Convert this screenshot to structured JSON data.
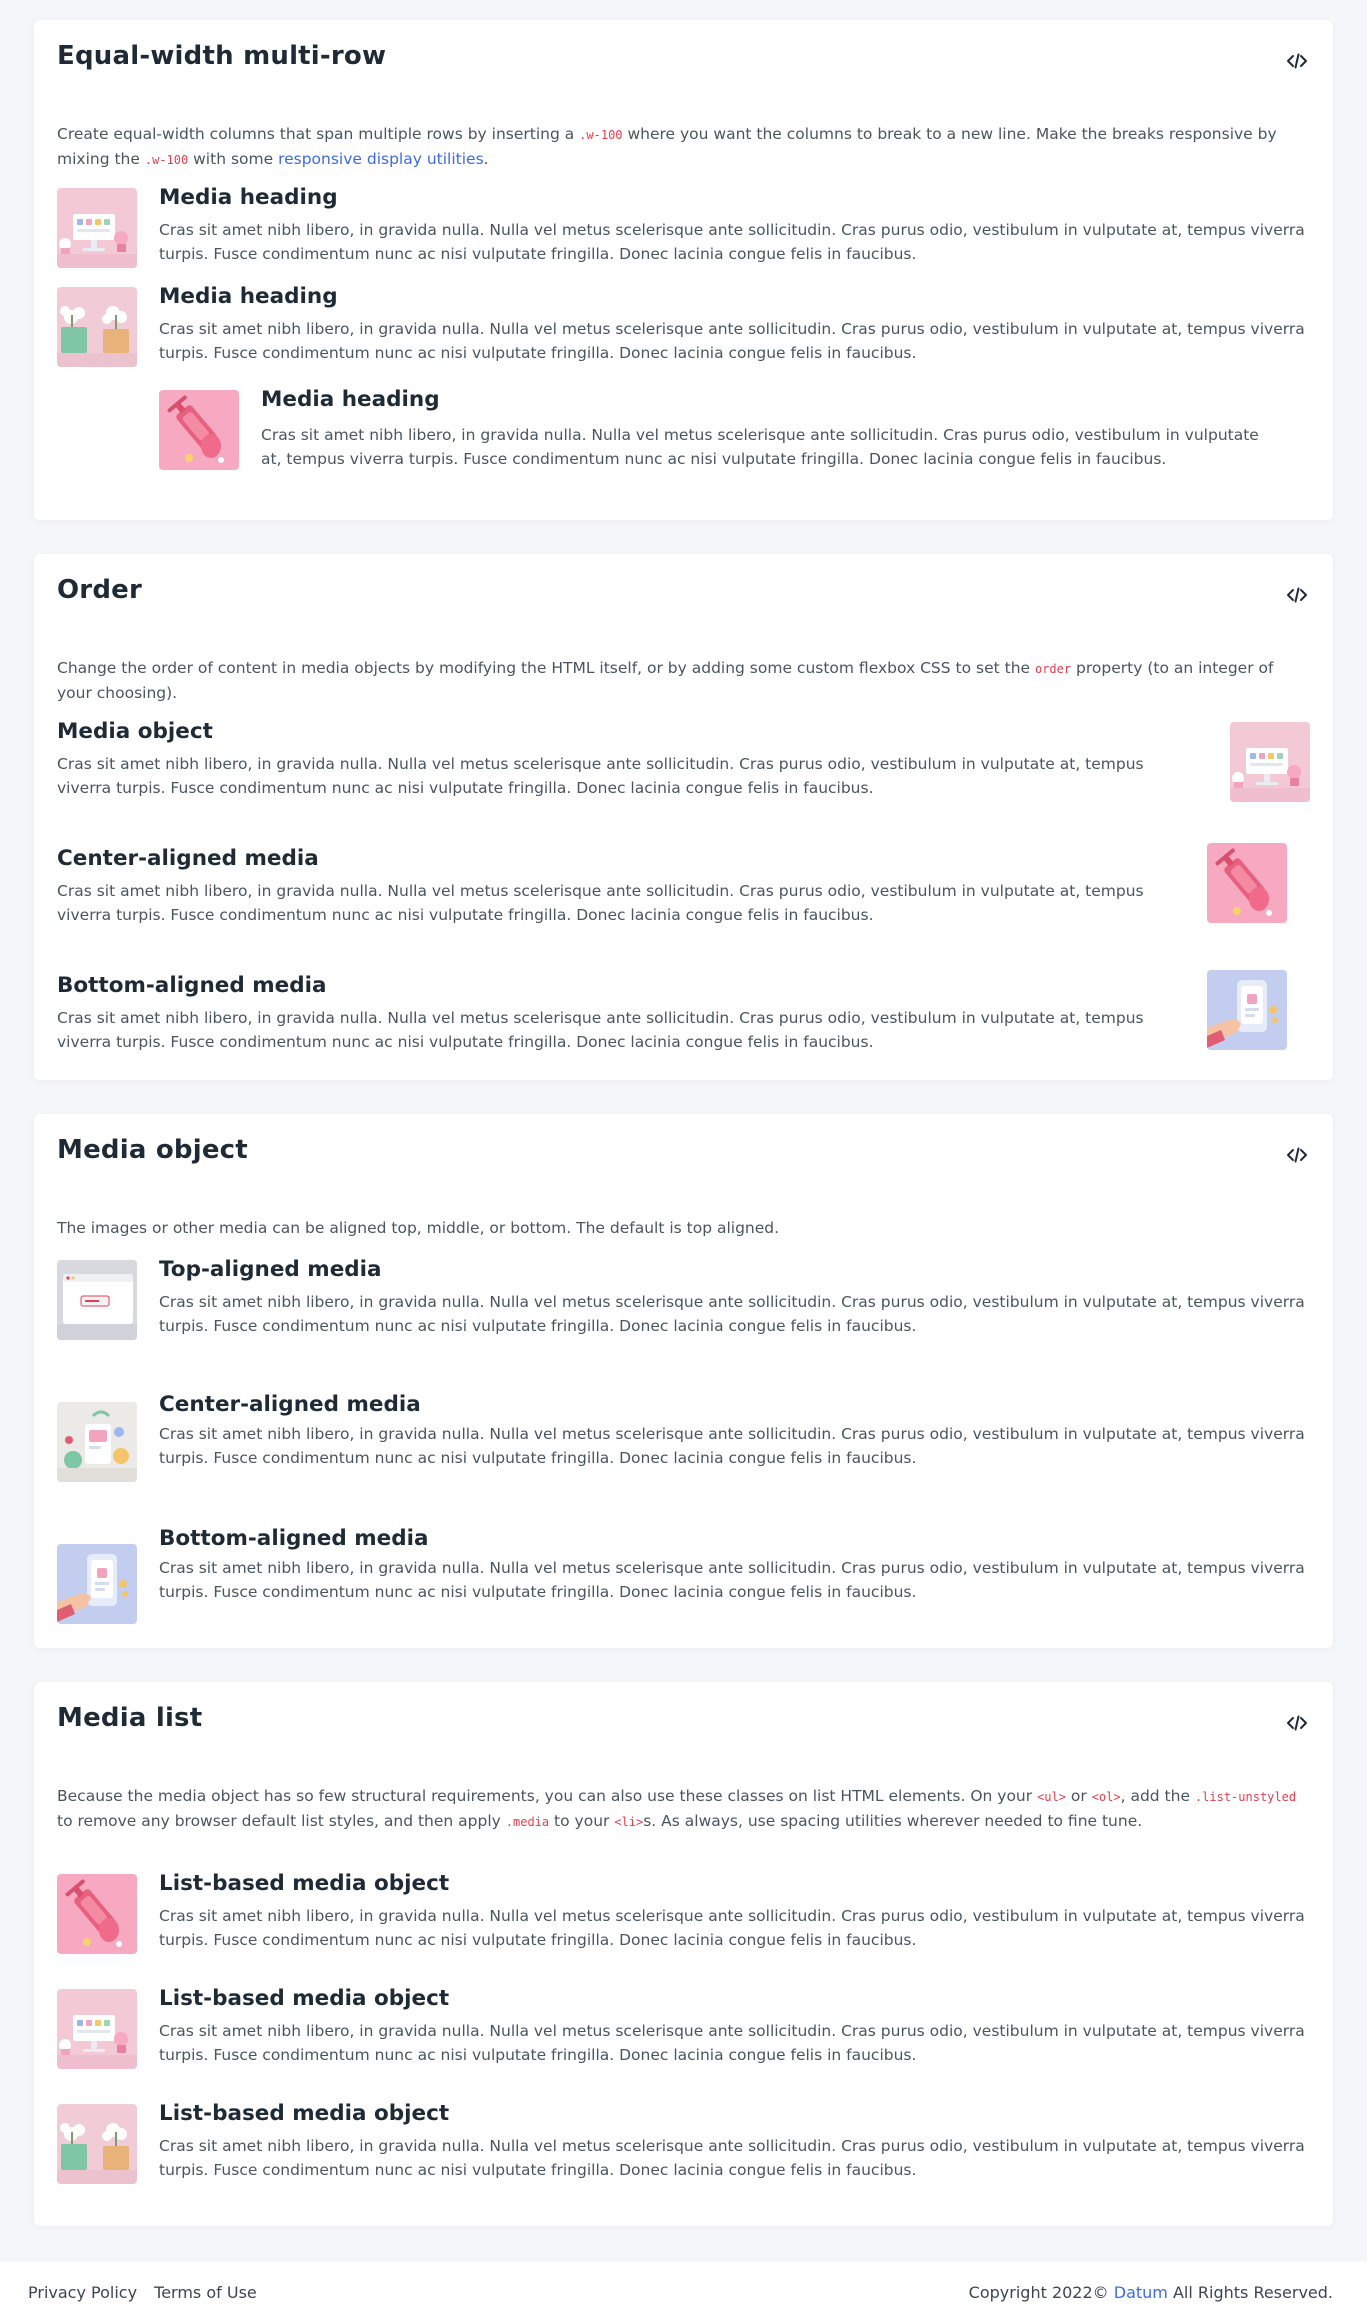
{
  "cards": [
    {
      "title": "Equal-width multi-row",
      "desc_a": "Create equal-width columns that span multiple rows by inserting a ",
      "code_a": ".w-100",
      "desc_b": " where you want the columns to break to a new line. Make the breaks responsive by mixing the ",
      "code_b": ".w-100",
      "desc_c": " with some ",
      "link": "responsive display utilities",
      "desc_d": ".",
      "items": [
        {
          "heading": "Media heading",
          "text": "Cras sit amet nibh libero, in gravida nulla. Nulla vel metus scelerisque ante sollicitudin. Cras purus odio, vestibulum in vulputate at, tempus viverra turpis. Fusce condimentum nunc ac nisi vulputate fringilla. Donec lacinia congue felis in faucibus.",
          "image": "desk-illustration"
        },
        {
          "heading": "Media heading",
          "text": "Cras sit amet nibh libero, in gravida nulla. Nulla vel metus scelerisque ante sollicitudin. Cras purus odio, vestibulum in vulputate at, tempus viverra turpis. Fusce condimentum nunc ac nisi vulputate fringilla. Donec lacinia congue felis in faucibus.",
          "image": "flower-pots-illustration"
        },
        {
          "heading": "Media heading",
          "text": "Cras sit amet nibh libero, in gravida nulla. Nulla vel metus scelerisque ante sollicitudin. Cras purus odio, vestibulum in vulputate at, tempus viverra turpis. Fusce condimentum nunc ac nisi vulputate fringilla. Donec lacinia congue felis in faucibus.",
          "image": "syringe-illustration"
        }
      ]
    },
    {
      "title": "Order",
      "desc_a": "Change the order of content in media objects by modifying the HTML itself, or by adding some custom flexbox CSS to set the ",
      "code_a": "order",
      "desc_b": " property (to an integer of your choosing).",
      "items": [
        {
          "heading": "Media object",
          "text": "Cras sit amet nibh libero, in gravida nulla. Nulla vel metus scelerisque ante sollicitudin. Cras purus odio, vestibulum in vulputate at, tempus viverra turpis. Fusce condimentum nunc ac nisi vulputate fringilla. Donec lacinia congue felis in faucibus.",
          "image": "desk-illustration"
        },
        {
          "heading": "Center-aligned media",
          "text": "Cras sit amet nibh libero, in gravida nulla. Nulla vel metus scelerisque ante sollicitudin. Cras purus odio, vestibulum in vulputate at, tempus viverra turpis. Fusce condimentum nunc ac nisi vulputate fringilla. Donec lacinia congue felis in faucibus.",
          "image": "syringe-illustration"
        },
        {
          "heading": "Bottom-aligned media",
          "text": "Cras sit amet nibh libero, in gravida nulla. Nulla vel metus scelerisque ante sollicitudin. Cras purus odio, vestibulum in vulputate at, tempus viverra turpis. Fusce condimentum nunc ac nisi vulputate fringilla. Donec lacinia congue felis in faucibus.",
          "image": "phone-hand-illustration"
        }
      ]
    },
    {
      "title": "Media object",
      "desc_a": "The images or other media can be aligned top, middle, or bottom. The default is top aligned.",
      "items": [
        {
          "heading": "Top-aligned media",
          "text": "Cras sit amet nibh libero, in gravida nulla. Nulla vel metus scelerisque ante sollicitudin. Cras purus odio, vestibulum in vulputate at, tempus viverra turpis. Fusce condimentum nunc ac nisi vulputate fringilla. Donec lacinia congue felis in faucibus.",
          "image": "browser-window-illustration"
        },
        {
          "heading": "Center-aligned media",
          "text": "Cras sit amet nibh libero, in gravida nulla. Nulla vel metus scelerisque ante sollicitudin. Cras purus odio, vestibulum in vulputate at, tempus viverra turpis. Fusce condimentum nunc ac nisi vulputate fringilla. Donec lacinia congue felis in faucibus.",
          "image": "garden-illustration"
        },
        {
          "heading": "Bottom-aligned media",
          "text": "Cras sit amet nibh libero, in gravida nulla. Nulla vel metus scelerisque ante sollicitudin. Cras purus odio, vestibulum in vulputate at, tempus viverra turpis. Fusce condimentum nunc ac nisi vulputate fringilla. Donec lacinia congue felis in faucibus.",
          "image": "phone-hand-illustration"
        }
      ]
    },
    {
      "title": "Media list",
      "desc_a": "Because the media object has so few structural requirements, you can also use these classes on list HTML elements. On your ",
      "code_a": "<ul>",
      "desc_b": " or ",
      "code_b": "<ol>",
      "desc_c": ", add the ",
      "code_c": ".list-unstyled",
      "desc_d": " to remove any browser default list styles, and then apply ",
      "code_d": ".media",
      "desc_e": " to your ",
      "code_e": "<li>",
      "desc_f": "s. As always, use spacing utilities wherever needed to fine tune.",
      "items": [
        {
          "heading": "List-based media object",
          "text": "Cras sit amet nibh libero, in gravida nulla. Nulla vel metus scelerisque ante sollicitudin. Cras purus odio, vestibulum in vulputate at, tempus viverra turpis. Fusce condimentum nunc ac nisi vulputate fringilla. Donec lacinia congue felis in faucibus.",
          "image": "syringe-illustration"
        },
        {
          "heading": "List-based media object",
          "text": "Cras sit amet nibh libero, in gravida nulla. Nulla vel metus scelerisque ante sollicitudin. Cras purus odio, vestibulum in vulputate at, tempus viverra turpis. Fusce condimentum nunc ac nisi vulputate fringilla. Donec lacinia congue felis in faucibus.",
          "image": "desk-illustration"
        },
        {
          "heading": "List-based media object",
          "text": "Cras sit amet nibh libero, in gravida nulla. Nulla vel metus scelerisque ante sollicitudin. Cras purus odio, vestibulum in vulputate at, tempus viverra turpis. Fusce condimentum nunc ac nisi vulputate fringilla. Donec lacinia congue felis in faucibus.",
          "image": "flower-pots-illustration"
        }
      ]
    }
  ],
  "footer": {
    "privacy": "Privacy Policy",
    "terms": "Terms of Use",
    "copyright_a": "Copyright 2022© ",
    "brand": "Datum",
    "copyright_b": " All Rights Reserved."
  },
  "colors": {
    "accent": "#3d6be8",
    "code": "#e5404f",
    "heading": "#1e2a35"
  }
}
